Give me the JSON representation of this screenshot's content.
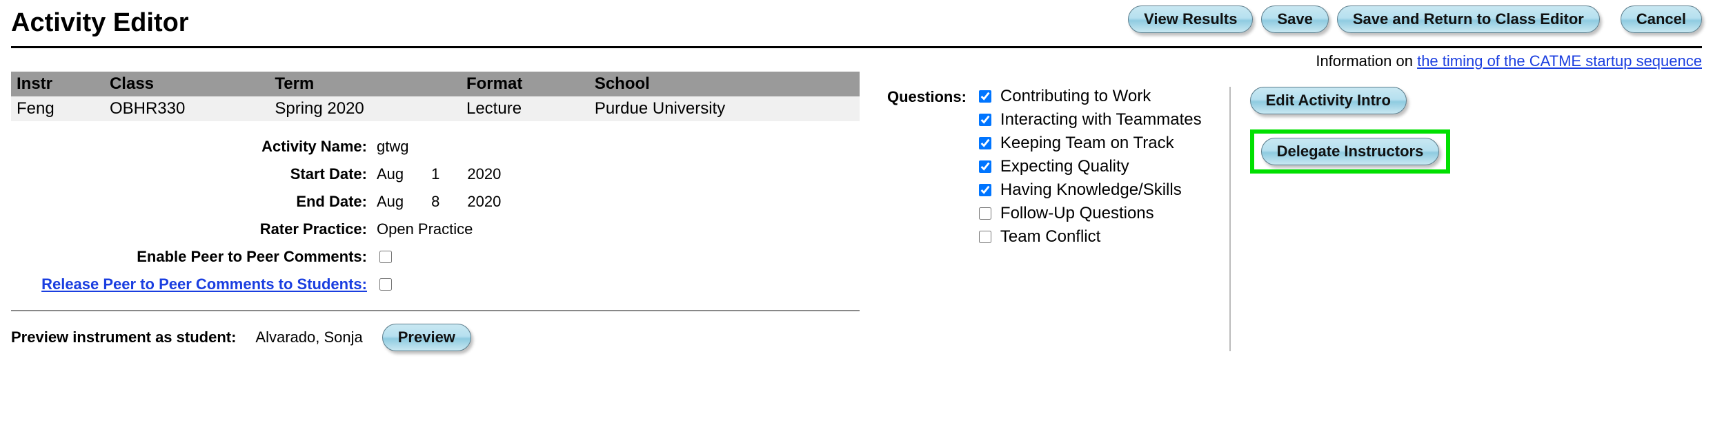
{
  "header": {
    "title": "Activity Editor",
    "buttons": {
      "view_results": "View Results",
      "save": "Save",
      "save_return": "Save and Return to Class Editor",
      "cancel": "Cancel"
    },
    "info_prefix": "Information on ",
    "info_link": "the timing of the CATME startup sequence"
  },
  "class_table": {
    "headers": {
      "instr": "Instr",
      "class": "Class",
      "term": "Term",
      "format": "Format",
      "school": "School"
    },
    "row": {
      "instr": "Feng",
      "class": "OBHR330",
      "term": "Spring 2020",
      "format": "Lecture",
      "school": "Purdue University"
    }
  },
  "details": {
    "activity_name_label": "Activity Name:",
    "activity_name_value": "gtwg",
    "start_date_label": "Start Date:",
    "start_date": {
      "month": "Aug",
      "day": "1",
      "year": "2020"
    },
    "end_date_label": "End Date:",
    "end_date": {
      "month": "Aug",
      "day": "8",
      "year": "2020"
    },
    "rater_practice_label": "Rater Practice:",
    "rater_practice_value": "Open Practice",
    "enable_p2p_label": "Enable Peer to Peer Comments:",
    "release_p2p_label": "Release Peer to Peer Comments to Students:"
  },
  "questions": {
    "label": "Questions:",
    "items": [
      {
        "label": "Contributing to Work",
        "checked": true
      },
      {
        "label": "Interacting with Teammates",
        "checked": true
      },
      {
        "label": "Keeping Team on Track",
        "checked": true
      },
      {
        "label": "Expecting Quality",
        "checked": true
      },
      {
        "label": "Having Knowledge/Skills",
        "checked": true
      },
      {
        "label": "Follow-Up Questions",
        "checked": false
      },
      {
        "label": "Team Conflict",
        "checked": false
      }
    ]
  },
  "side_buttons": {
    "edit_intro": "Edit Activity Intro",
    "delegate": "Delegate Instructors"
  },
  "preview": {
    "label": "Preview instrument as student:",
    "student": "Alvarado, Sonja",
    "button": "Preview"
  }
}
